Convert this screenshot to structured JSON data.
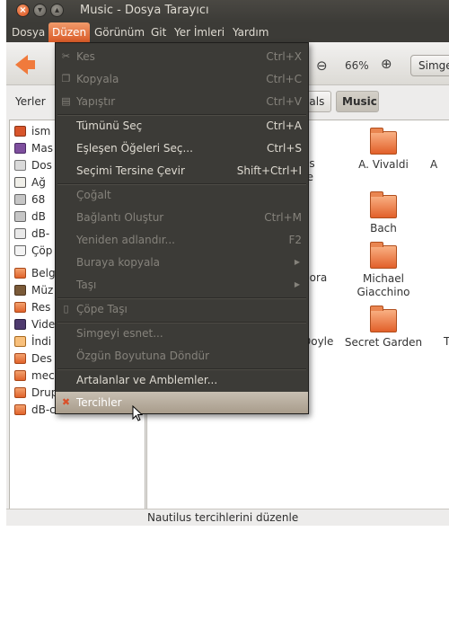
{
  "window": {
    "title": "Music - Dosya Tarayıcı"
  },
  "menubar": {
    "items": [
      "Dosya",
      "Düzen",
      "Görünüm",
      "Git",
      "Yer İmleri",
      "Yardım"
    ],
    "active": "Düzen"
  },
  "toolbar": {
    "zoom_level": "66%",
    "view_label": "Simge"
  },
  "location": {
    "places_label": "Yerler",
    "crumb_prev": "ivals",
    "crumb_current": "Music"
  },
  "edit_menu": {
    "cut": {
      "label": "Kes",
      "accel": "Ctrl+X"
    },
    "copy": {
      "label": "Kopyala",
      "accel": "Ctrl+C"
    },
    "paste": {
      "label": "Yapıştır",
      "accel": "Ctrl+V"
    },
    "select_all": {
      "label": "Tümünü Seç",
      "accel": "Ctrl+A"
    },
    "select_pattern": {
      "label": "Eşleşen Öğeleri Seç...",
      "accel": "Ctrl+S"
    },
    "invert_selection": {
      "label": "Seçimi Tersine Çevir",
      "accel": "Shift+Ctrl+I"
    },
    "duplicate": {
      "label": "Çoğalt"
    },
    "make_link": {
      "label": "Bağlantı Oluştur",
      "accel": "Ctrl+M"
    },
    "rename": {
      "label": "Yeniden adlandır...",
      "accel": "F2"
    },
    "copy_to": {
      "label": "Buraya kopyala"
    },
    "move_to": {
      "label": "Taşı"
    },
    "move_to_trash": {
      "label": "Çöpe Taşı"
    },
    "stretch_icon": {
      "label": "Simgeyi esnet..."
    },
    "restore_icon": {
      "label": "Özgün Boyutuna Döndür"
    },
    "backgrounds": {
      "label": "Artalanlar ve Amblemler..."
    },
    "preferences": {
      "label": "Tercihler"
    }
  },
  "sidebar": {
    "items": [
      {
        "label": "ism",
        "icon": "home-folder-icon"
      },
      {
        "label": "Mas",
        "icon": "desktop-icon"
      },
      {
        "label": "Dos",
        "icon": "filesystem-icon"
      },
      {
        "label": "Ağ",
        "icon": "network-icon"
      },
      {
        "label": "68",
        "icon": "harddisk-icon"
      },
      {
        "label": "dB",
        "icon": "harddisk-icon"
      },
      {
        "label": "dB-",
        "icon": "usb-drive-icon"
      },
      {
        "label": "Çöp",
        "icon": "trash-icon"
      },
      {
        "label": "Belg",
        "icon": "folder-icon"
      },
      {
        "label": "Müz",
        "icon": "music-folder-icon"
      },
      {
        "label": "Res",
        "icon": "pictures-folder-icon"
      },
      {
        "label": "Vide",
        "icon": "video-folder-icon"
      },
      {
        "label": "İndi",
        "icon": "downloads-folder-icon"
      },
      {
        "label": "Des",
        "icon": "folder-icon"
      },
      {
        "label": "mec",
        "icon": "folder-icon"
      },
      {
        "label": "Drupal",
        "icon": "folder-icon"
      },
      {
        "label": "dB-courses",
        "icon": "folder-icon"
      }
    ]
  },
  "content": {
    "items": [
      {
        "line1": "A. Vivaldi",
        "line2": ""
      },
      {
        "line1": "A",
        "line2": ""
      },
      {
        "line1": "os",
        "line2": "re"
      },
      {
        "line1": "Bach",
        "line2": ""
      },
      {
        "line1": "gora",
        "line2": "o"
      },
      {
        "line1": "Michael",
        "line2": "Giacchino"
      },
      {
        "line1": "Doyle",
        "line2": ""
      },
      {
        "line1": "Secret Garden",
        "line2": ""
      },
      {
        "line1": "T",
        "line2": ""
      }
    ]
  },
  "statusbar": {
    "text": "Nautilus tercihlerini düzenle"
  }
}
